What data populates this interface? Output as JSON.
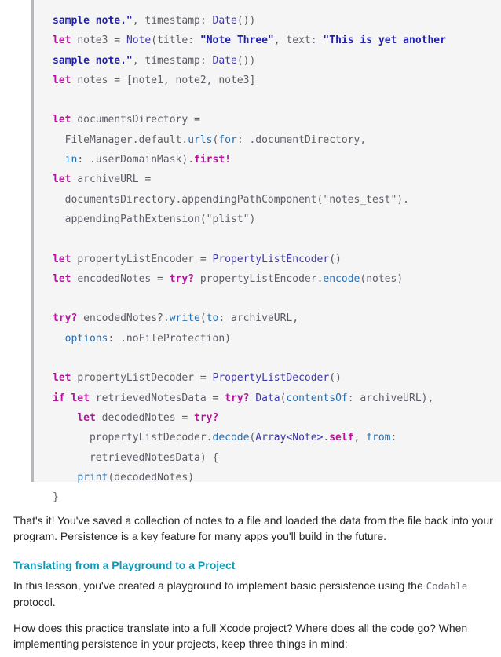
{
  "code": {
    "lines": [
      [
        {
          "t": "sample note.\"",
          "c": "s"
        },
        {
          "t": ", timestamp: ",
          "c": "p"
        },
        {
          "t": "Date",
          "c": "t"
        },
        {
          "t": "())",
          "c": "p"
        }
      ],
      [
        {
          "t": "let ",
          "c": "k"
        },
        {
          "t": "note3 = ",
          "c": "p"
        },
        {
          "t": "Note",
          "c": "t"
        },
        {
          "t": "(title: ",
          "c": "p"
        },
        {
          "t": "\"Note Three\"",
          "c": "s"
        },
        {
          "t": ", text: ",
          "c": "p"
        },
        {
          "t": "\"This is yet another",
          "c": "s"
        }
      ],
      [
        {
          "t": "sample note.\"",
          "c": "s"
        },
        {
          "t": ", timestamp: ",
          "c": "p"
        },
        {
          "t": "Date",
          "c": "t"
        },
        {
          "t": "())",
          "c": "p"
        }
      ],
      [
        {
          "t": "let ",
          "c": "k"
        },
        {
          "t": "notes = [note1, note2, note3]",
          "c": "p"
        }
      ],
      [],
      [
        {
          "t": "let ",
          "c": "k"
        },
        {
          "t": "documentsDirectory =",
          "c": "p"
        }
      ],
      [
        {
          "t": "  FileManager.default.",
          "c": "p"
        },
        {
          "t": "urls",
          "c": "f"
        },
        {
          "t": "(",
          "c": "p"
        },
        {
          "t": "for",
          "c": "f"
        },
        {
          "t": ": .documentDirectory,",
          "c": "p"
        }
      ],
      [
        {
          "t": "  ",
          "c": "p"
        },
        {
          "t": "in",
          "c": "f"
        },
        {
          "t": ": .userDomainMask).",
          "c": "p"
        },
        {
          "t": "first!",
          "c": "k"
        }
      ],
      [
        {
          "t": "let ",
          "c": "k"
        },
        {
          "t": "archiveURL =",
          "c": "p"
        }
      ],
      [
        {
          "t": "  documentsDirectory.appendingPathComponent(\"notes_test\").",
          "c": "p"
        }
      ],
      [
        {
          "t": "  appendingPathExtension(\"plist\")",
          "c": "p"
        }
      ],
      [],
      [
        {
          "t": "let ",
          "c": "k"
        },
        {
          "t": "propertyListEncoder = ",
          "c": "p"
        },
        {
          "t": "PropertyListEncoder",
          "c": "t"
        },
        {
          "t": "()",
          "c": "p"
        }
      ],
      [
        {
          "t": "let ",
          "c": "k"
        },
        {
          "t": "encodedNotes = ",
          "c": "p"
        },
        {
          "t": "try?",
          "c": "k"
        },
        {
          "t": " propertyListEncoder.",
          "c": "p"
        },
        {
          "t": "encode",
          "c": "f"
        },
        {
          "t": "(notes)",
          "c": "p"
        }
      ],
      [],
      [
        {
          "t": "try?",
          "c": "k"
        },
        {
          "t": " encodedNotes?.",
          "c": "p"
        },
        {
          "t": "write",
          "c": "f"
        },
        {
          "t": "(",
          "c": "p"
        },
        {
          "t": "to",
          "c": "f"
        },
        {
          "t": ": archiveURL,",
          "c": "p"
        }
      ],
      [
        {
          "t": "  ",
          "c": "p"
        },
        {
          "t": "options",
          "c": "f"
        },
        {
          "t": ": .noFileProtection)",
          "c": "p"
        }
      ],
      [],
      [
        {
          "t": "let ",
          "c": "k"
        },
        {
          "t": "propertyListDecoder = ",
          "c": "p"
        },
        {
          "t": "PropertyListDecoder",
          "c": "t"
        },
        {
          "t": "()",
          "c": "p"
        }
      ],
      [
        {
          "t": "if let ",
          "c": "k"
        },
        {
          "t": "retrievedNotesData = ",
          "c": "p"
        },
        {
          "t": "try? ",
          "c": "k"
        },
        {
          "t": "Data",
          "c": "t"
        },
        {
          "t": "(",
          "c": "p"
        },
        {
          "t": "contentsOf",
          "c": "f"
        },
        {
          "t": ": archiveURL),",
          "c": "p"
        }
      ],
      [
        {
          "t": "    ",
          "c": "p"
        },
        {
          "t": "let ",
          "c": "k"
        },
        {
          "t": "decodedNotes = ",
          "c": "p"
        },
        {
          "t": "try?",
          "c": "k"
        }
      ],
      [
        {
          "t": "      propertyListDecoder.",
          "c": "p"
        },
        {
          "t": "decode",
          "c": "f"
        },
        {
          "t": "(",
          "c": "p"
        },
        {
          "t": "Array<Note>",
          "c": "t"
        },
        {
          "t": ".",
          "c": "p"
        },
        {
          "t": "self",
          "c": "k"
        },
        {
          "t": ", ",
          "c": "p"
        },
        {
          "t": "from",
          "c": "f"
        },
        {
          "t": ":",
          "c": "p"
        }
      ],
      [
        {
          "t": "      retrievedNotesData) {",
          "c": "p"
        }
      ],
      [
        {
          "t": "    ",
          "c": "p"
        },
        {
          "t": "print",
          "c": "f"
        },
        {
          "t": "(decodedNotes)",
          "c": "p"
        }
      ],
      [
        {
          "t": "}",
          "c": "p"
        }
      ]
    ]
  },
  "paragraph1": "That's it! You've saved a collection of notes to a file and loaded the data from the file back into your program. Persistence is a key feature for many apps you'll build in the future.",
  "heading": "Translating from a Playground to a Project",
  "paragraph2": {
    "before": "In this lesson, you've created a playground to implement basic persistence using the ",
    "code": "Codable",
    "after": " protocol."
  },
  "paragraph3": "How does this practice translate into a full Xcode project? Where does all the code go? When implementing persistence in your projects, keep three things in mind:"
}
